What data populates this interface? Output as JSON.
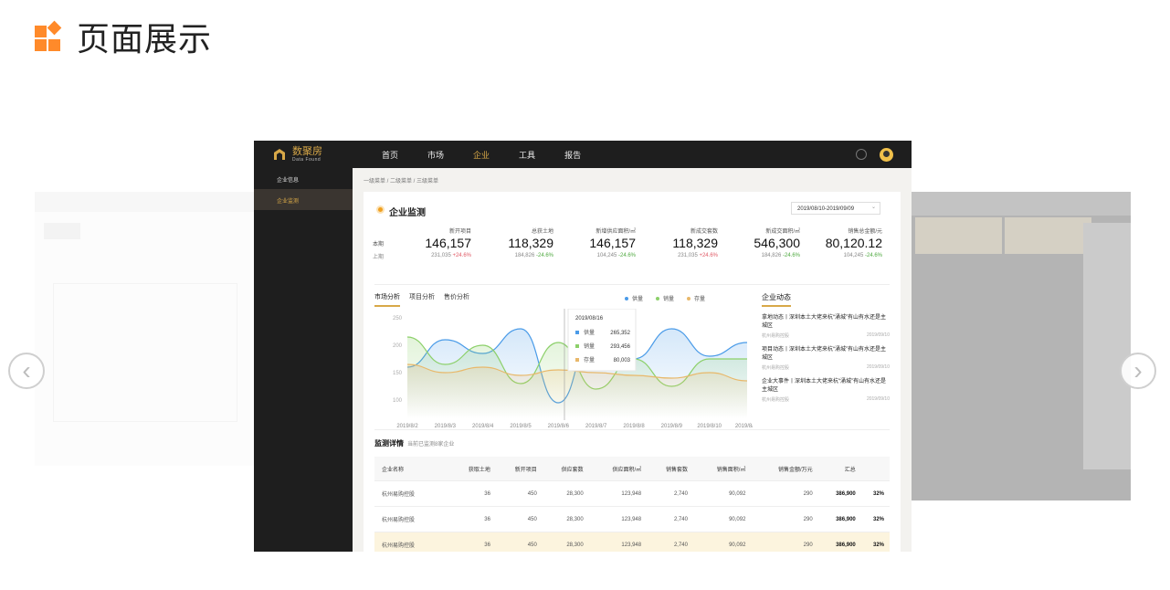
{
  "page": {
    "title": "页面展示"
  },
  "nav": {
    "prev": "‹",
    "next": "›"
  },
  "app": {
    "brand": {
      "name": "数聚房",
      "sub": "Data Found"
    },
    "topnav": [
      "首页",
      "市场",
      "企业",
      "工具",
      "报告"
    ],
    "sidebar": [
      "企业信息",
      "企业监测"
    ],
    "breadcrumb": "一级菜单 / 二级菜单 / 三级菜单",
    "card_title": "企业监测",
    "date_range": "2019/08/10-2019/09/09",
    "kpi": {
      "row_current": "本期",
      "row_previous": "上期",
      "columns": [
        "新开项目",
        "总获土地",
        "新增供应面积/㎡",
        "新成交套数",
        "新成交面积/㎡",
        "销售总金额/元"
      ],
      "current": [
        "146,157",
        "118,329",
        "146,157",
        "118,329",
        "546,300",
        "80,120.12"
      ],
      "previous": [
        {
          "value": "231,035",
          "change": "+24.6%",
          "dir": "up"
        },
        {
          "value": "184,826",
          "change": "-24.6%",
          "dir": "down"
        },
        {
          "value": "104,245",
          "change": "-24.6%",
          "dir": "down"
        },
        {
          "value": "231,035",
          "change": "+24.6%",
          "dir": "up"
        },
        {
          "value": "184,826",
          "change": "-24.6%",
          "dir": "down"
        },
        {
          "value": "104,245",
          "change": "-24.6%",
          "dir": "down"
        }
      ]
    },
    "tabs": [
      "市场分析",
      "项目分析",
      "售价分析"
    ],
    "legend": [
      {
        "name": "供量",
        "color": "#4a9be8"
      },
      {
        "name": "销量",
        "color": "#8cd06a"
      },
      {
        "name": "存量",
        "color": "#e8b86a"
      }
    ],
    "tooltip": {
      "date": "2019/08/16",
      "items": [
        {
          "name": "供量",
          "value": "265,352"
        },
        {
          "name": "销量",
          "value": "293,456"
        },
        {
          "name": "存量",
          "value": "80,003"
        }
      ]
    },
    "news": {
      "title": "企业动态",
      "items": [
        {
          "text": "拿地动态丨深圳本土大佬来杭“涌城”有山有水还是主城区",
          "source": "杭州易购控股",
          "date": "2019/09/10"
        },
        {
          "text": "项目动态丨深圳本土大佬来杭“涌城”有山有水还是主城区",
          "source": "杭州易购控股",
          "date": "2019/09/10"
        },
        {
          "text": "企业大事件丨深圳本土大佬来杭“涌城”有山有水还是主城区",
          "source": "杭州易购控股",
          "date": "2019/09/10"
        }
      ]
    },
    "detail": {
      "title": "监测详情",
      "subtitle": "当前已监测8家企业",
      "headers": [
        "企业名称",
        "获取土地",
        "新开项目",
        "供应套数",
        "供应面积/㎡",
        "销售套数",
        "销售面积/㎡",
        "销售金额/万元",
        "汇总",
        ""
      ],
      "rows": [
        [
          "杭州易购控股",
          "36",
          "450",
          "28,300",
          "123,948",
          "2,740",
          "90,092",
          "290",
          "386,900",
          "32%"
        ],
        [
          "杭州易购控股",
          "36",
          "450",
          "28,300",
          "123,948",
          "2,740",
          "90,092",
          "290",
          "386,900",
          "32%"
        ],
        [
          "杭州易购控股",
          "36",
          "450",
          "28,300",
          "123,948",
          "2,740",
          "90,092",
          "290",
          "386,900",
          "32%"
        ]
      ]
    }
  },
  "chart_data": {
    "type": "line",
    "x": [
      "2019/8/2",
      "2019/8/3",
      "2019/8/4",
      "2019/8/5",
      "2019/8/6",
      "2019/8/7",
      "2019/8/8",
      "2019/8/9",
      "2019/8/10",
      "2019/8/11"
    ],
    "yticks": [
      "250",
      "200",
      "150",
      "100"
    ],
    "ylim": [
      100,
      250
    ],
    "series": [
      {
        "name": "供量",
        "color": "#4a9be8",
        "values": [
          160,
          210,
          185,
          230,
          95,
          240,
          175,
          230,
          180,
          205
        ]
      },
      {
        "name": "销量",
        "color": "#8cd06a",
        "values": [
          215,
          165,
          200,
          130,
          205,
          120,
          175,
          125,
          175,
          175
        ]
      },
      {
        "name": "存量",
        "color": "#e8b86a",
        "values": [
          165,
          150,
          160,
          145,
          155,
          150,
          145,
          140,
          150,
          135
        ]
      }
    ]
  }
}
